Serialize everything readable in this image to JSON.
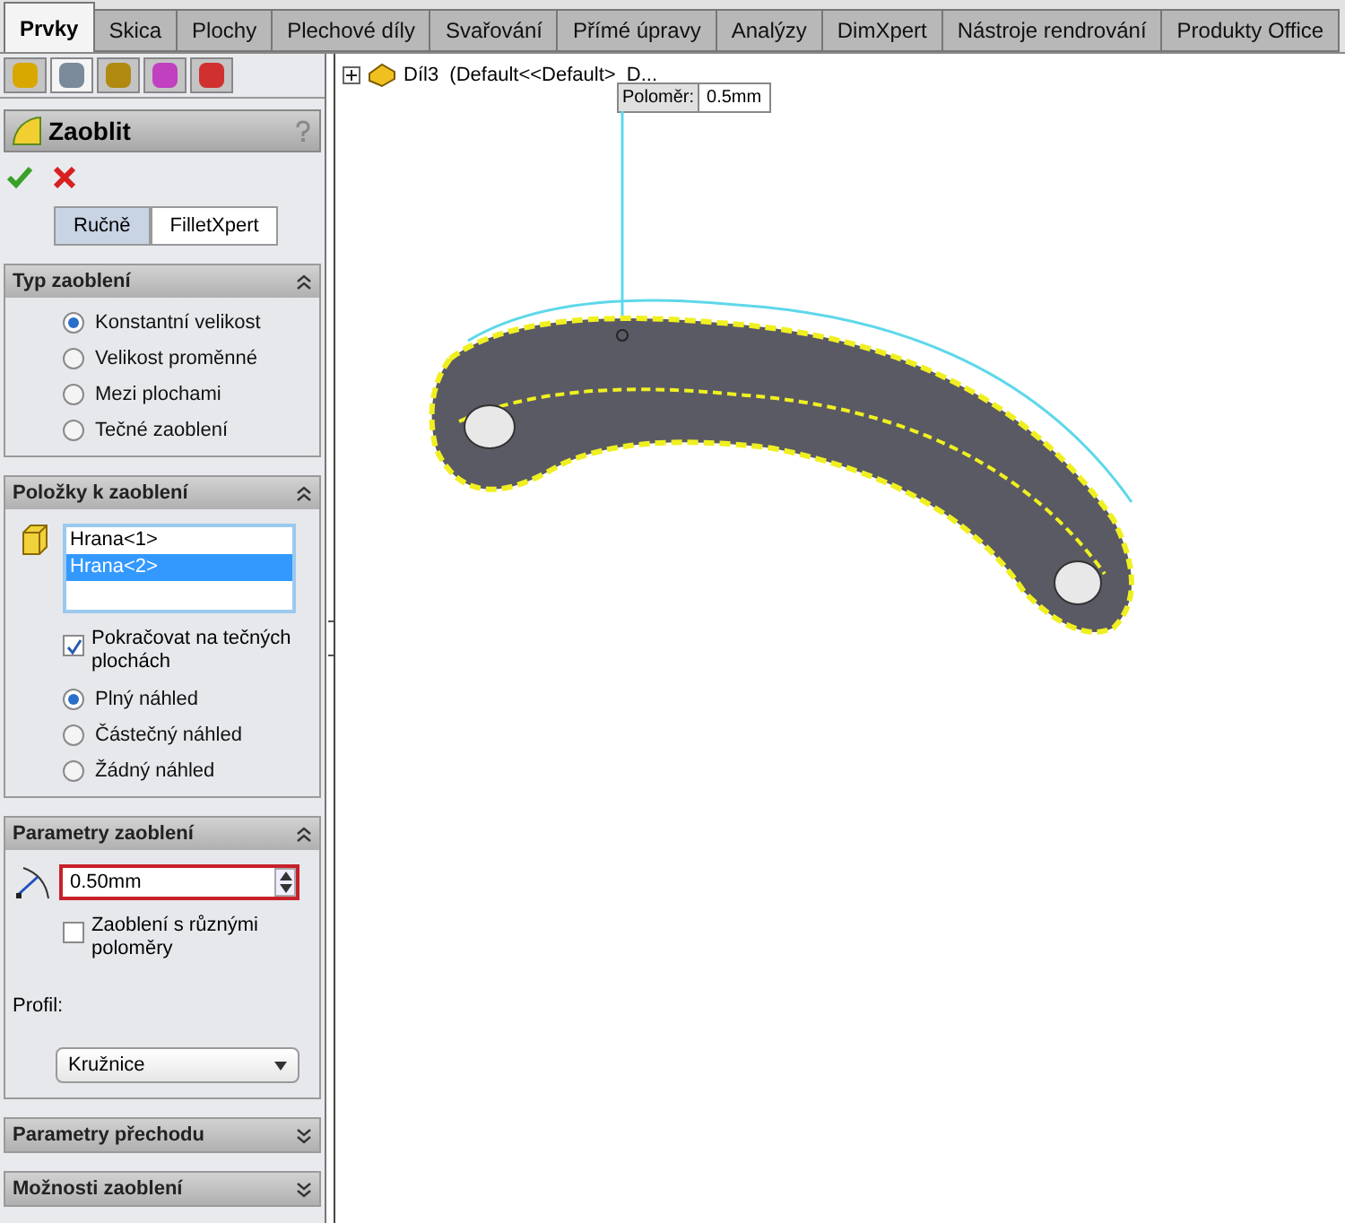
{
  "tabs": [
    {
      "label": "Prvky",
      "selected": true
    },
    {
      "label": "Skica",
      "selected": false
    },
    {
      "label": "Plochy",
      "selected": false
    },
    {
      "label": "Plechové díly",
      "selected": false
    },
    {
      "label": "Svařování",
      "selected": false
    },
    {
      "label": "Přímé úpravy",
      "selected": false
    },
    {
      "label": "Analýzy",
      "selected": false
    },
    {
      "label": "DimXpert",
      "selected": false
    },
    {
      "label": "Nástroje rendrování",
      "selected": false
    },
    {
      "label": "Produkty Office",
      "selected": false
    }
  ],
  "manager_tabs": [
    {
      "selected": false
    },
    {
      "selected": true
    },
    {
      "selected": false
    },
    {
      "selected": false
    },
    {
      "selected": false
    }
  ],
  "property_manager": {
    "title": "Zaoblit",
    "mode_buttons": [
      {
        "label": "Ručně",
        "selected": true
      },
      {
        "label": "FilletXpert",
        "selected": false
      }
    ],
    "sections": [
      {
        "title": "Typ zaoblení",
        "expanded": true,
        "items": [
          {
            "kind": "radio",
            "label": "Konstantní velikost",
            "checked": true
          },
          {
            "kind": "radio",
            "label": "Velikost proměnné",
            "checked": false
          },
          {
            "kind": "radio",
            "label": "Mezi plochami",
            "checked": false
          },
          {
            "kind": "radio",
            "label": "Tečné zaoblení",
            "checked": false
          }
        ]
      },
      {
        "title": "Položky k zaoblení",
        "expanded": true,
        "items": [
          {
            "kind": "list",
            "entries": [
              {
                "label": "Hrana<1>",
                "selected": false
              },
              {
                "label": "Hrana<2>",
                "selected": true
              }
            ]
          },
          {
            "kind": "checkbox",
            "label": "Pokračovat na tečných plochách",
            "checked": true
          },
          {
            "kind": "radio",
            "label": "Plný náhled",
            "checked": true
          },
          {
            "kind": "radio",
            "label": "Částečný náhled",
            "checked": false
          },
          {
            "kind": "radio",
            "label": "Žádný náhled",
            "checked": false
          }
        ]
      },
      {
        "title": "Parametry zaoblení",
        "expanded": true,
        "items": [
          {
            "kind": "spin",
            "value": "0.50mm"
          },
          {
            "kind": "checkbox",
            "label": "Zaoblení s různými poloměry",
            "checked": false
          },
          {
            "kind": "label",
            "label": "Profil:"
          },
          {
            "kind": "dropdown",
            "value": "Kružnice"
          }
        ]
      },
      {
        "title": "Parametry přechodu",
        "expanded": false
      },
      {
        "title": "Možnosti zaoblení",
        "expanded": false
      }
    ]
  },
  "tree": {
    "label": "Díl3  (Default<<Default>  D..."
  },
  "callout": {
    "label": "Poloměr:",
    "value": "0.5mm"
  }
}
